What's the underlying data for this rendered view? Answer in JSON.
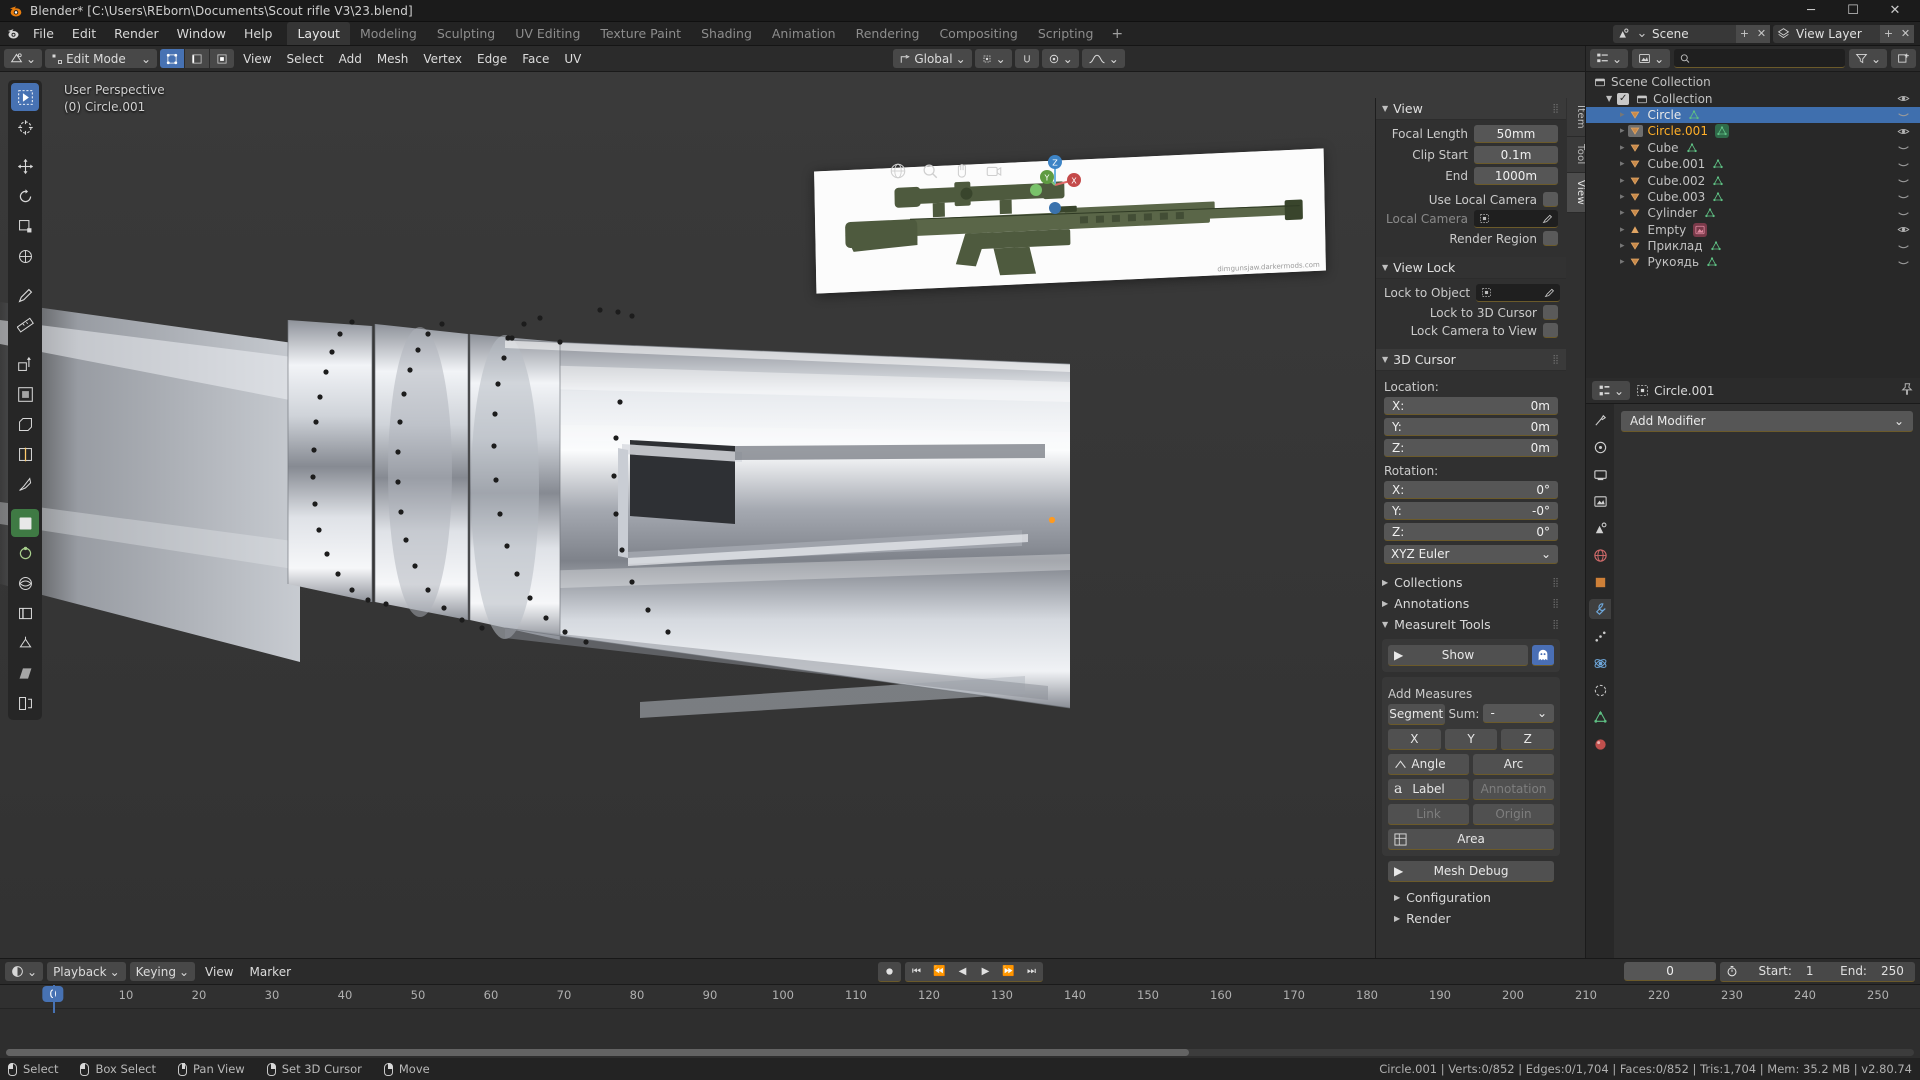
{
  "window": {
    "title": "Blender* [C:\\Users\\REborn\\Documents\\Scout rifle V3\\23.blend]",
    "minimize": "─",
    "maximize": "☐",
    "close": "✕"
  },
  "topbar": {
    "menus": [
      "File",
      "Edit",
      "Render",
      "Window",
      "Help"
    ],
    "workspaces": [
      {
        "label": "Layout",
        "active": true
      },
      {
        "label": "Modeling",
        "active": false
      },
      {
        "label": "Sculpting",
        "active": false
      },
      {
        "label": "UV Editing",
        "active": false
      },
      {
        "label": "Texture Paint",
        "active": false
      },
      {
        "label": "Shading",
        "active": false
      },
      {
        "label": "Animation",
        "active": false
      },
      {
        "label": "Rendering",
        "active": false
      },
      {
        "label": "Compositing",
        "active": false
      },
      {
        "label": "Scripting",
        "active": false
      }
    ],
    "add_workspace": "+",
    "scene_name": "Scene",
    "viewlayer_name": "View Layer"
  },
  "viewport": {
    "mode": "Edit Mode",
    "menus": [
      "View",
      "Select",
      "Add",
      "Mesh",
      "Vertex",
      "Edge",
      "Face",
      "UV"
    ],
    "transform_orientation": "Global",
    "overlay_line1": "User Perspective",
    "overlay_line2": "(0) Circle.001",
    "ref_caption": "dimgunsjaw.darkermods.com",
    "gizmo_axes": [
      "Z",
      "Y",
      "X"
    ]
  },
  "sidebar": {
    "tabs": [
      {
        "label": "Item",
        "active": false
      },
      {
        "label": "Tool",
        "active": false
      },
      {
        "label": "View",
        "active": true
      }
    ],
    "view_panel": {
      "title": "View",
      "focal_length_label": "Focal Length",
      "focal_length": "50mm",
      "clip_start_label": "Clip Start",
      "clip_start": "0.1m",
      "clip_end_label": "End",
      "clip_end": "1000m",
      "use_local_camera_label": "Use Local Camera",
      "local_camera_label": "Local Camera",
      "render_region_label": "Render Region"
    },
    "view_lock_panel": {
      "title": "View Lock",
      "lock_to_object_label": "Lock to Object",
      "lock_to_3d_cursor_label": "Lock to 3D Cursor",
      "lock_camera_to_view_label": "Lock Camera to View"
    },
    "cursor_panel": {
      "title": "3D Cursor",
      "location_label": "Location:",
      "location": [
        {
          "axis": "X:",
          "value": "0m"
        },
        {
          "axis": "Y:",
          "value": "0m"
        },
        {
          "axis": "Z:",
          "value": "0m"
        }
      ],
      "rotation_label": "Rotation:",
      "rotation": [
        {
          "axis": "X:",
          "value": "0°"
        },
        {
          "axis": "Y:",
          "value": "-0°"
        },
        {
          "axis": "Z:",
          "value": "0°"
        }
      ],
      "rotation_mode": "XYZ Euler"
    },
    "collections_panel": "Collections",
    "annotations_panel": "Annotations",
    "measureit_panel": {
      "title": "MeasureIt Tools",
      "show_label": "Show",
      "add_measures_label": "Add Measures",
      "segment_label": "Segment",
      "sum_label": "Sum:",
      "sum_value": "-",
      "axis_buttons": [
        "X",
        "Y",
        "Z"
      ],
      "angle_label": "Angle",
      "arc_label": "Arc",
      "label_label": "Label",
      "annotation_label": "Annotation",
      "link_label": "Link",
      "origin_label": "Origin",
      "area_label": "Area",
      "mesh_debug_label": "Mesh Debug",
      "configuration_label": "Configuration",
      "render_label": "Render"
    }
  },
  "outliner": {
    "search_placeholder": "",
    "root": "Scene Collection",
    "collection": "Collection",
    "items": [
      {
        "name": "Circle",
        "selected": true,
        "active": false,
        "depth": 2,
        "visible_icon": "closed-eye"
      },
      {
        "name": "Circle.001",
        "selected": false,
        "active": true,
        "depth": 2,
        "visible_icon": "open-eye"
      },
      {
        "name": "Cube",
        "selected": false,
        "active": false,
        "depth": 2,
        "visible_icon": "closed-eye"
      },
      {
        "name": "Cube.001",
        "selected": false,
        "active": false,
        "depth": 2,
        "visible_icon": "closed-eye"
      },
      {
        "name": "Cube.002",
        "selected": false,
        "active": false,
        "depth": 2,
        "visible_icon": "closed-eye"
      },
      {
        "name": "Cube.003",
        "selected": false,
        "active": false,
        "depth": 2,
        "visible_icon": "closed-eye"
      },
      {
        "name": "Cylinder",
        "selected": false,
        "active": false,
        "depth": 2,
        "visible_icon": "closed-eye"
      },
      {
        "name": "Empty",
        "selected": false,
        "active": false,
        "depth": 2,
        "visible_icon": "open-eye"
      },
      {
        "name": "Приклад",
        "selected": false,
        "active": false,
        "depth": 2,
        "visible_icon": "closed-eye"
      },
      {
        "name": "Рукоядь",
        "selected": false,
        "active": false,
        "depth": 2,
        "visible_icon": "closed-eye"
      }
    ]
  },
  "properties": {
    "breadcrumb_object": "Circle.001",
    "add_modifier_label": "Add Modifier"
  },
  "timeline": {
    "editor_menus": [
      "Playback",
      "Keying",
      "View",
      "Marker"
    ],
    "current_frame": "0",
    "start_label": "Start:",
    "start_value": "1",
    "end_label": "End:",
    "end_value": "250",
    "ticks": [
      0,
      10,
      20,
      30,
      40,
      50,
      60,
      70,
      80,
      90,
      100,
      110,
      120,
      130,
      140,
      150,
      160,
      170,
      180,
      190,
      200,
      210,
      220,
      230,
      240,
      250
    ],
    "playhead_frame": 0
  },
  "statusbar": {
    "hints": [
      {
        "mouse": "l",
        "label": "Select"
      },
      {
        "mouse": "l",
        "label": "Box Select"
      },
      {
        "mouse": "m",
        "label": "Pan View"
      },
      {
        "mouse": "r",
        "label": "Set 3D Cursor"
      },
      {
        "mouse": "r",
        "label": "Move"
      }
    ],
    "stats": "Circle.001 | Verts:0/852 | Edges:0/1,704 | Faces:0/852 | Tris:1,704 | Mem: 35.2 MB | v2.80.74"
  },
  "colors": {
    "accent_blue": "#4772b3",
    "active_orange": "#ffaf29",
    "mesh_green": "#5ebf83",
    "panel_bg": "#303030",
    "header_bg": "#2b2b2b"
  }
}
